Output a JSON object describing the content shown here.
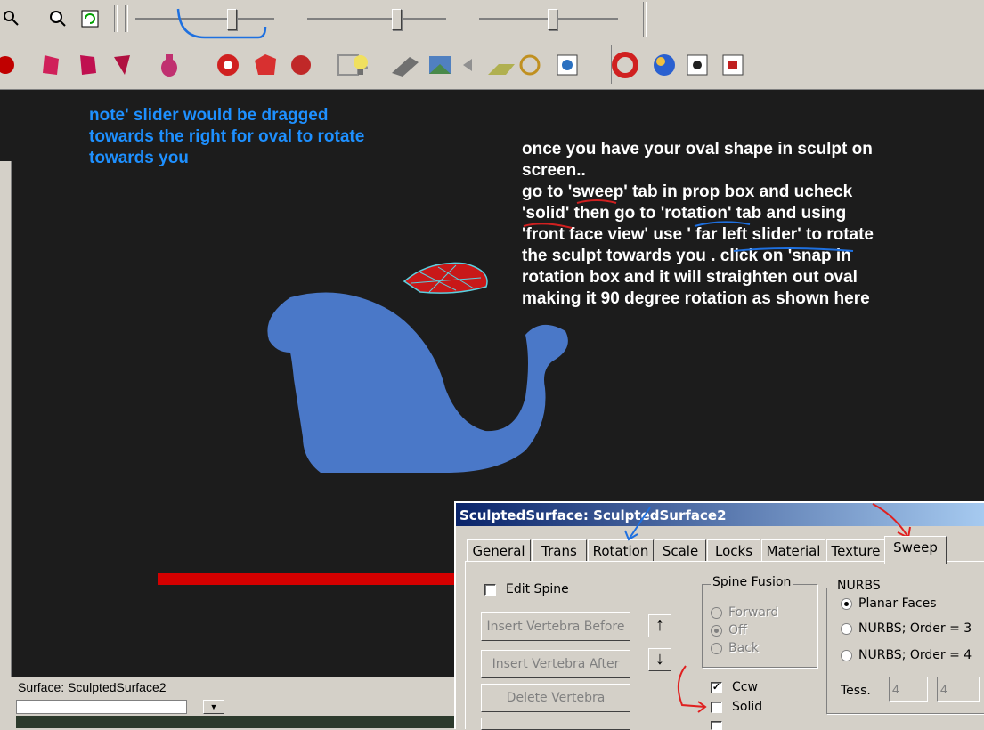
{
  "toolbar": {
    "icons_row1": [
      "zoom-icon",
      "zoom-out-icon",
      "refresh-icon"
    ],
    "icons_row2": [
      "sphere-icon",
      "cube-icon",
      "cube-faceted-icon",
      "prism-icon",
      "vase-icon",
      "gem-icon",
      "torus-icon",
      "sphere-red-icon",
      "grid-icon",
      "light-bulb-icon",
      "spotlight-icon",
      "landscape-icon",
      "sound-icon",
      "ground-icon",
      "helm-icon",
      "cube-3d-icon",
      "lifering-icon",
      "globe-icon",
      "spider-icon",
      "box-icon"
    ]
  },
  "notes": {
    "blue_note": [
      "note' slider would be dragged",
      "towards the right for oval to rotate",
      "towards you"
    ],
    "white_note": [
      "once you have your oval shape in sculpt on",
      "screen..",
      "go to 'sweep' tab in prop box and ucheck",
      "'solid' then go to 'rotation' tab and using",
      "'front face view' use ' far left slider' to rotate",
      "the sculpt towards you . click on 'snap in",
      "rotation box and it will straighten out oval",
      "making it 90 degree rotation as shown here"
    ]
  },
  "status": {
    "text": "Surface:  SculptedSurface2"
  },
  "dialog": {
    "title": "SculptedSurface: SculptedSurface2",
    "tabs": [
      "General",
      "Trans",
      "Rotation",
      "Scale",
      "Locks",
      "Material",
      "Texture",
      "Sweep"
    ],
    "active_tab": "Sweep",
    "edit_spine": "Edit Spine",
    "buttons": [
      "Insert Vertebra Before",
      "Insert Vertebra After",
      "Delete Vertebra"
    ],
    "spine_fusion": {
      "label": "Spine Fusion",
      "options": [
        "Forward",
        "Off",
        "Back"
      ],
      "selected": "Off"
    },
    "ccw": "Ccw",
    "solid": "Solid",
    "nurbs": {
      "label": "NURBS",
      "options": [
        "Planar Faces",
        "NURBS;  Order = 3",
        "NURBS;  Order = 4"
      ],
      "selected": "Planar Faces"
    },
    "tess_label": "Tess.",
    "tess_values": [
      "4",
      "4"
    ]
  },
  "colors": {
    "viewport": "#1c1c1c",
    "blue_text": "#1e90ff",
    "shape": "#4a78c8",
    "red_line": "#d40000"
  }
}
